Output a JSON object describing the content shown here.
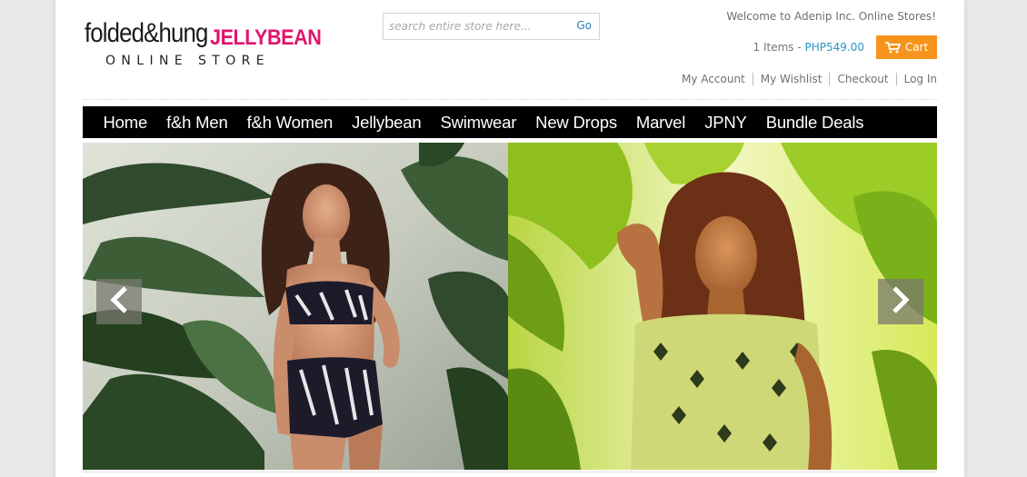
{
  "logo": {
    "brand_part1": "folded&hung",
    "brand_part2": "JELLYBEAN",
    "tagline": "ONLINE STORE",
    "brand_pink": "#e0156b"
  },
  "search": {
    "placeholder": "search entire store here...",
    "go_label": "Go"
  },
  "header": {
    "welcome": "Welcome to Adenip Inc. Online Stores!",
    "cart_items": "1 Items - ",
    "cart_total": "PHP549.00",
    "cart_label": "Cart",
    "cart_color": "#f7941d"
  },
  "account_links": [
    "My Account",
    "My Wishlist",
    "Checkout",
    "Log In"
  ],
  "nav": [
    "Home",
    "f&h Men",
    "f&h Women",
    "Jellybean",
    "Swimwear",
    "New Drops",
    "Marvel",
    "JPNY",
    "Bundle Deals"
  ],
  "slider": {
    "prev_icon": "chevron-left-icon",
    "next_icon": "chevron-right-icon"
  }
}
